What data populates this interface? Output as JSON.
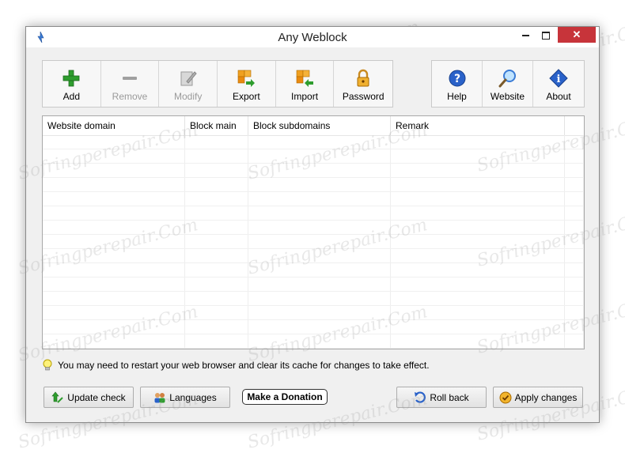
{
  "window": {
    "title": "Any Weblock"
  },
  "toolbar": {
    "add": "Add",
    "remove": "Remove",
    "modify": "Modify",
    "export": "Export",
    "import": "Import",
    "password": "Password",
    "help": "Help",
    "website": "Website",
    "about": "About"
  },
  "table": {
    "columns": [
      "Website domain",
      "Block main",
      "Block subdomains",
      "Remark"
    ],
    "rows": []
  },
  "hint": {
    "text": "You may need to restart your web browser and clear its cache for changes to take effect."
  },
  "buttons": {
    "update_check": "Update check",
    "languages": "Languages",
    "donate": "Make a Donation",
    "roll_back": "Roll back",
    "apply_changes": "Apply changes"
  },
  "watermark": "Sofringperepair.Com",
  "colors": {
    "close_button": "#c7343a",
    "add_green": "#2e9d2e",
    "export_orange": "#f0a020"
  }
}
